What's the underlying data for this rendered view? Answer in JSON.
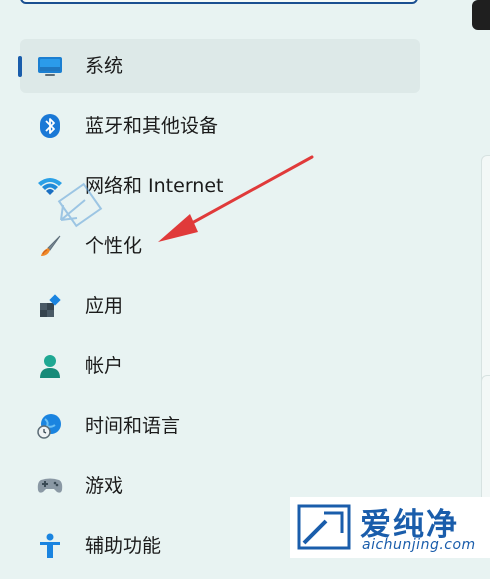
{
  "nav": {
    "items": [
      {
        "label": "系统",
        "icon": "monitor-icon",
        "selected": true
      },
      {
        "label": "蓝牙和其他设备",
        "icon": "bluetooth-icon"
      },
      {
        "label": "网络和 Internet",
        "icon": "wifi-icon"
      },
      {
        "label": "个性化",
        "icon": "brush-icon"
      },
      {
        "label": "应用",
        "icon": "apps-icon"
      },
      {
        "label": "帐户",
        "icon": "account-icon"
      },
      {
        "label": "时间和语言",
        "icon": "globe-clock-icon"
      },
      {
        "label": "游戏",
        "icon": "gamepad-icon"
      },
      {
        "label": "辅助功能",
        "icon": "accessibility-icon"
      }
    ]
  },
  "watermark": {
    "brand": "爱纯净",
    "url": "aichunjing.com"
  },
  "colors": {
    "accent": "#1a5dab",
    "arrow": "#e03a3a",
    "background": "#e8f3f2",
    "selected_background": "#dde9e8"
  }
}
